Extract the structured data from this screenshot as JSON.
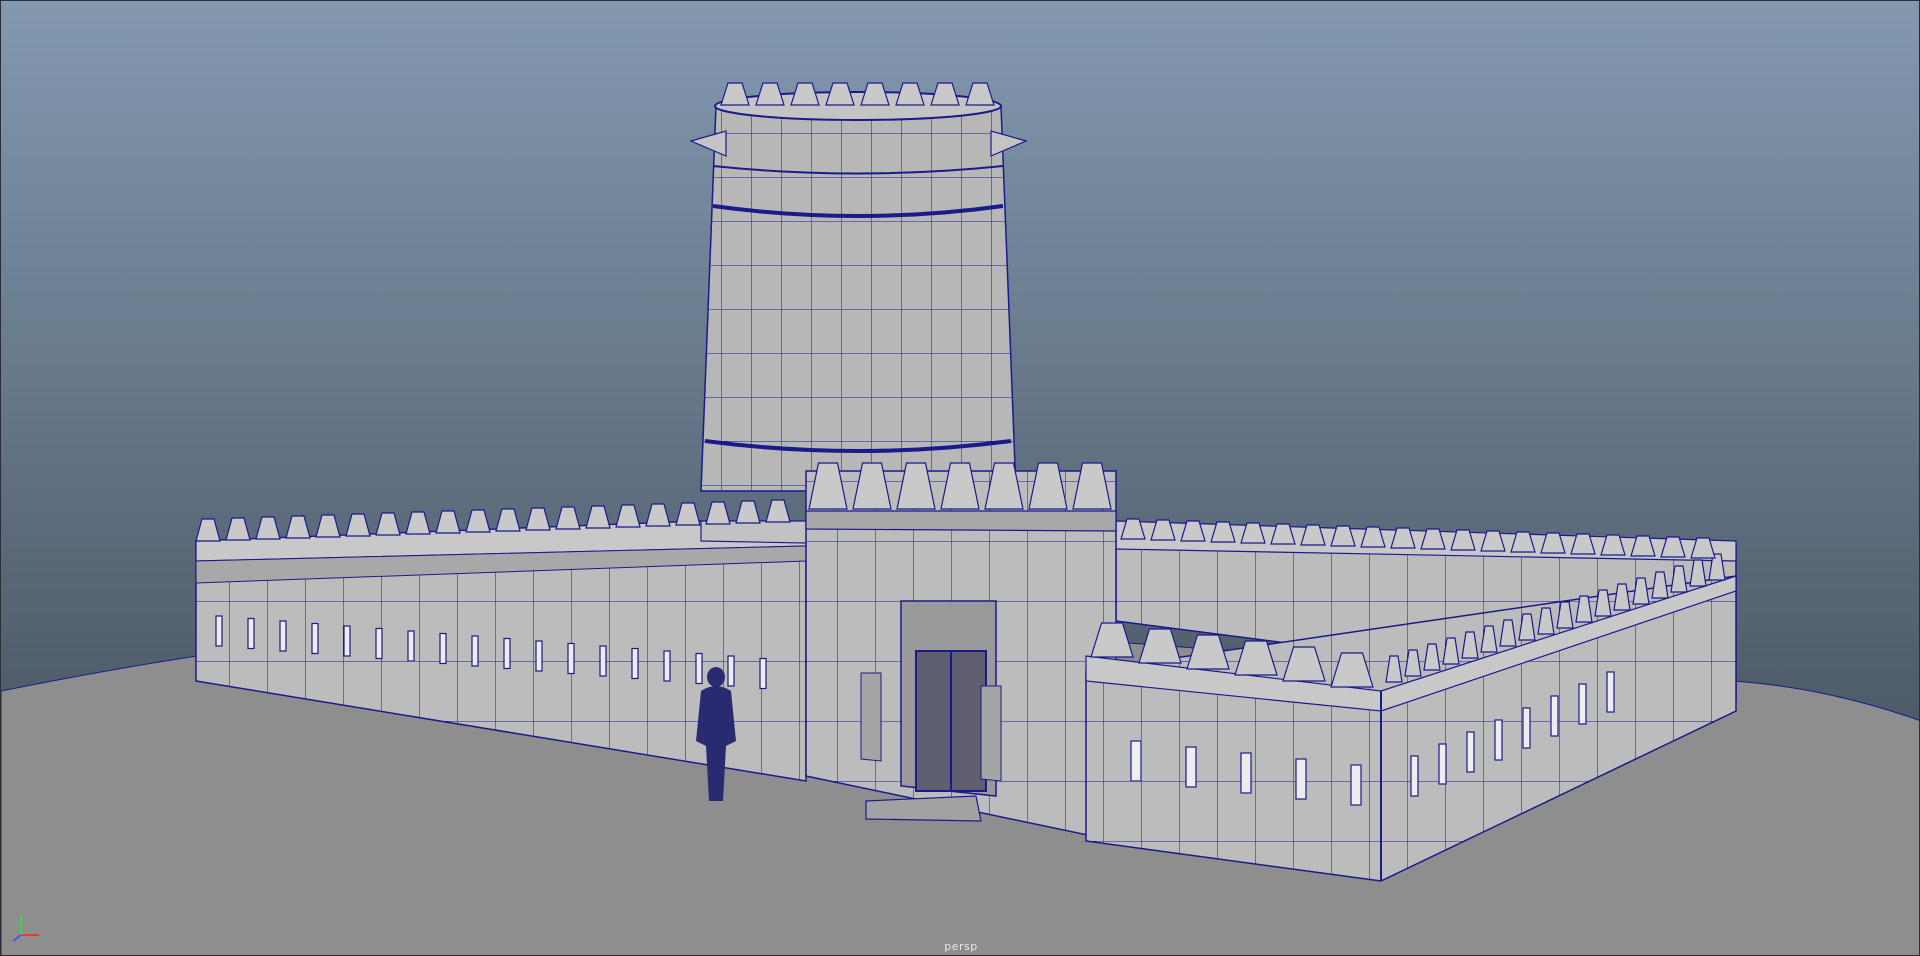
{
  "viewport": {
    "camera_name": "persp",
    "gradient_top": "#8399b0",
    "gradient_bottom": "#3c4650",
    "wire_color": "#1a1a8c",
    "surface_color": "#b9b9b9",
    "ground_color": "#8c8c8c"
  },
  "gizmo": {
    "icons": [
      "x-axis-icon",
      "y-axis-icon",
      "z-axis-icon"
    ],
    "colors": {
      "x": "#e23b3b",
      "y": "#3bd14a",
      "z": "#3b5be2"
    }
  }
}
